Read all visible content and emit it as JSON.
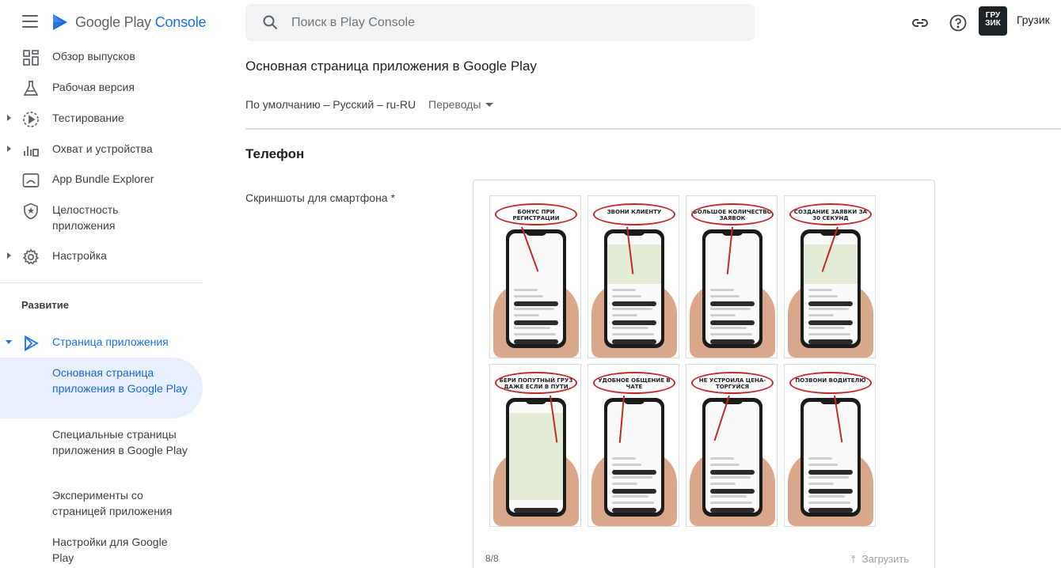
{
  "brand": {
    "name_part1": "Google Play",
    "name_part2": "Console"
  },
  "search": {
    "placeholder": "Поиск в Play Console"
  },
  "account": {
    "avatar_text": "ГРУ ЗИК",
    "name": "Грузик"
  },
  "sidebar": {
    "items": [
      {
        "label": "Обзор выпусков",
        "icon": "dashboard-icon"
      },
      {
        "label": "Рабочая версия",
        "icon": "flask-icon"
      },
      {
        "label": "Тестирование",
        "icon": "play-circle-icon"
      },
      {
        "label": "Охват и устройства",
        "icon": "bar-chart-icon"
      },
      {
        "label": "App Bundle Explorer",
        "icon": "bundle-icon"
      },
      {
        "label": "Целостность приложения",
        "icon": "shield-icon"
      },
      {
        "label": "Настройка",
        "icon": "gear-icon"
      }
    ],
    "section_title": "Развитие",
    "group": {
      "label": "Страница приложения",
      "icon": "play-logo-icon"
    },
    "subitems": [
      {
        "label": "Основная страница приложения в Google Play",
        "active": true
      },
      {
        "label": "Специальные страницы приложения в Google Play"
      },
      {
        "label": "Эксперименты со страницей приложения"
      },
      {
        "label": "Настройки для Google Play"
      }
    ]
  },
  "main": {
    "title": "Основная страница приложения в Google Play",
    "language": "По умолчанию – Русский – ru-RU",
    "translations": "Переводы",
    "section": "Телефон",
    "screenshots_label": "Скриншоты для смартфона  *",
    "screenshots": [
      {
        "caption": "Бонус при регистрации"
      },
      {
        "caption": "Звони клиенту"
      },
      {
        "caption": "Большое количество заявок"
      },
      {
        "caption": "Создание заявки за 30 секунд"
      },
      {
        "caption": "Бери попутный груз даже если в пути"
      },
      {
        "caption": "Удобное общение в чате"
      },
      {
        "caption": "Не устроила цена- торгуйся"
      },
      {
        "caption": "Позвони водителю"
      }
    ],
    "count": "8/8",
    "upload": "Загрузить"
  },
  "colors": {
    "accent": "#1a73e8",
    "active_bg": "#e8f0fe",
    "annotation_red": "#c62828"
  }
}
